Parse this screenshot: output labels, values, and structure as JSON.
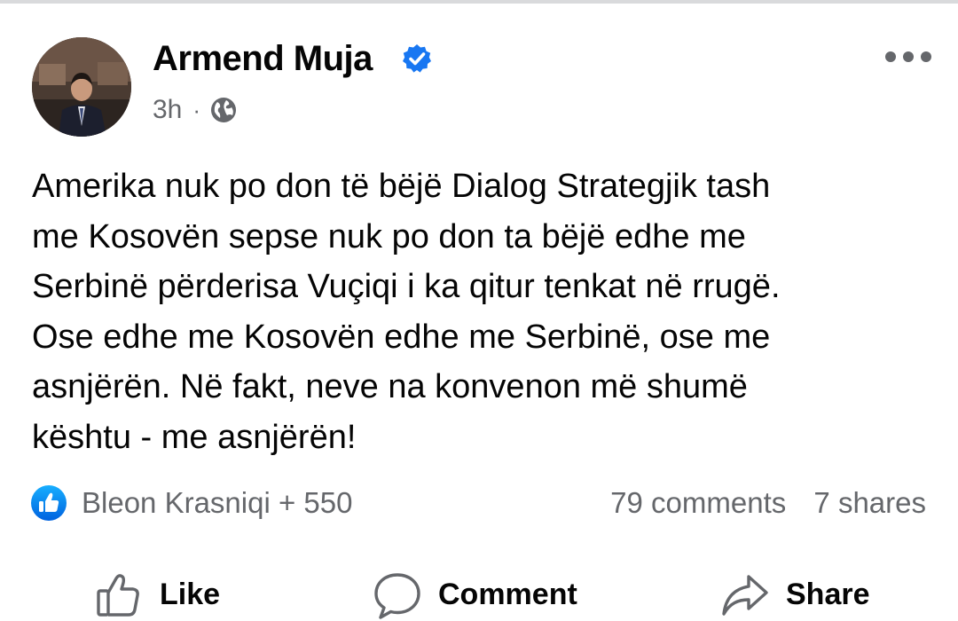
{
  "post": {
    "author": {
      "name": "Armend Muja",
      "verified": true,
      "avatar_icon": "person-photo-avatar"
    },
    "time": "3h",
    "separator": "·",
    "audience_icon": "globe-icon",
    "text": "Amerika nuk po don të bëjë Dialog Strategjik tash\nme Kosovën sepse nuk po don ta bëjë edhe me\nSerbinë përderisa Vuçiqi i ka qitur tenkat në rrugë.\nOse edhe me Kosovën edhe me Serbinë, ose me\nasnjërën. Në fakt, neve na konvenon më shumë\nkështu - me asnjërën!",
    "reactions": {
      "icon": "like-badge-icon",
      "summary": "Bleon Krasniqi + 550"
    },
    "comments": "79 comments",
    "shares": "7 shares",
    "actions": {
      "like": "Like",
      "comment": "Comment",
      "share": "Share"
    }
  },
  "colors": {
    "primary_text": "#050505",
    "secondary_text": "#65676b",
    "facebook_blue": "#1877f2",
    "divider": "#d9dadc"
  }
}
